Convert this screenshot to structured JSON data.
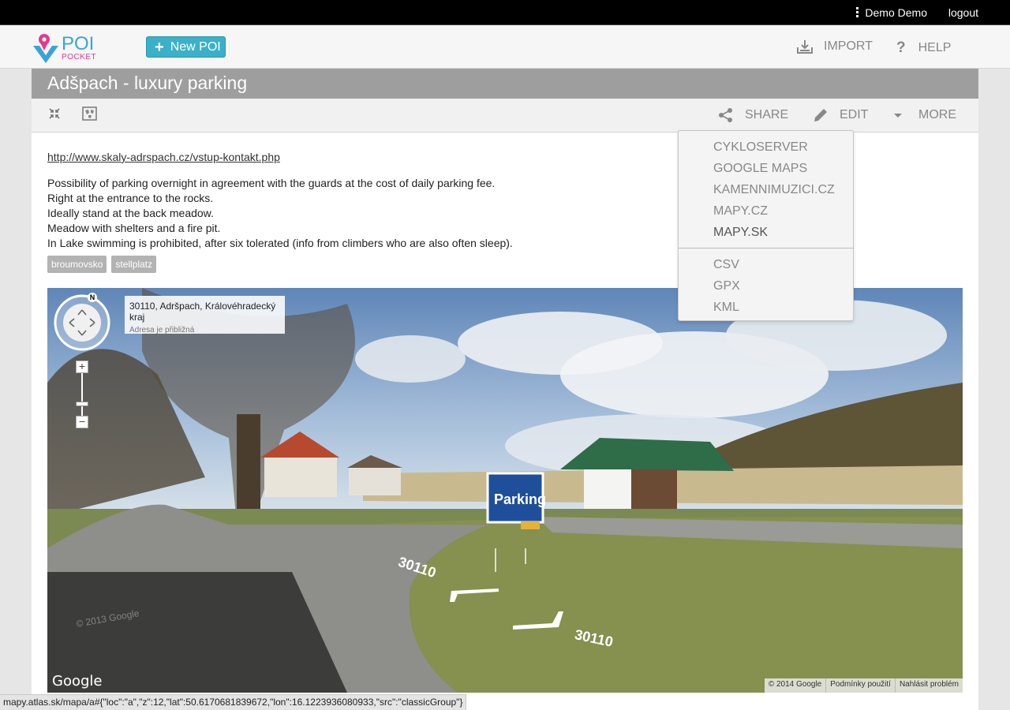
{
  "topbar": {
    "user_name": "Demo Demo",
    "logout_label": "logout"
  },
  "header": {
    "logo_poi": "POI",
    "logo_pocket": "POCKET",
    "new_poi_label": "New POI",
    "import_label": "IMPORT",
    "help_label": "HELP"
  },
  "poi": {
    "title": "Adšpach - luxury parking",
    "url": "http://www.skaly-adrspach.cz/vstup-kontakt.php",
    "description": [
      "Possibility of parking overnight in agreement with the guards at the cost of daily parking fee.",
      "Right at the entrance to the rocks.",
      "Ideally stand at the back meadow.",
      "Meadow with shelters and a fire pit.",
      "In Lake swimming is prohibited, after six tolerated (info from climbers who are also often sleep)."
    ],
    "tags": [
      "broumovsko",
      "stellplatz"
    ]
  },
  "toolbar": {
    "share_label": "SHARE",
    "edit_label": "EDIT",
    "more_label": "MORE"
  },
  "more_menu": {
    "map_links": [
      "CYKLOSERVER",
      "GOOGLE MAPS",
      "KAMENNIMUZICI.CZ",
      "MAPY.CZ",
      "MAPY.SK"
    ],
    "exports": [
      "CSV",
      "GPX",
      "KML"
    ]
  },
  "streetview": {
    "address": "30110, Adršpach, Královéhradecký kraj",
    "address_note": "Adresa je přibližná",
    "compass_label": "N",
    "road_label_1": "30110",
    "road_label_2": "30110",
    "parking_sign": "Parking",
    "google_logo": "Google",
    "watermark": "© 2013 Google",
    "footer": [
      "© 2014 Google",
      "Podmínky použití",
      "Nahlásit problém"
    ]
  },
  "statusbar": {
    "url": "mapy.atlas.sk/mapa/a#{\"loc\":\"a\",\"z\":12,\"lat\":50.6170681839672,\"lon\":16.1223936080933,\"src\":\"classicGroup\"}"
  },
  "colors": {
    "accent": "#3bb0c9",
    "logo_blue": "#3aa4d8",
    "logo_pink": "#e4398f",
    "title_bar": "#9e9e9e"
  }
}
